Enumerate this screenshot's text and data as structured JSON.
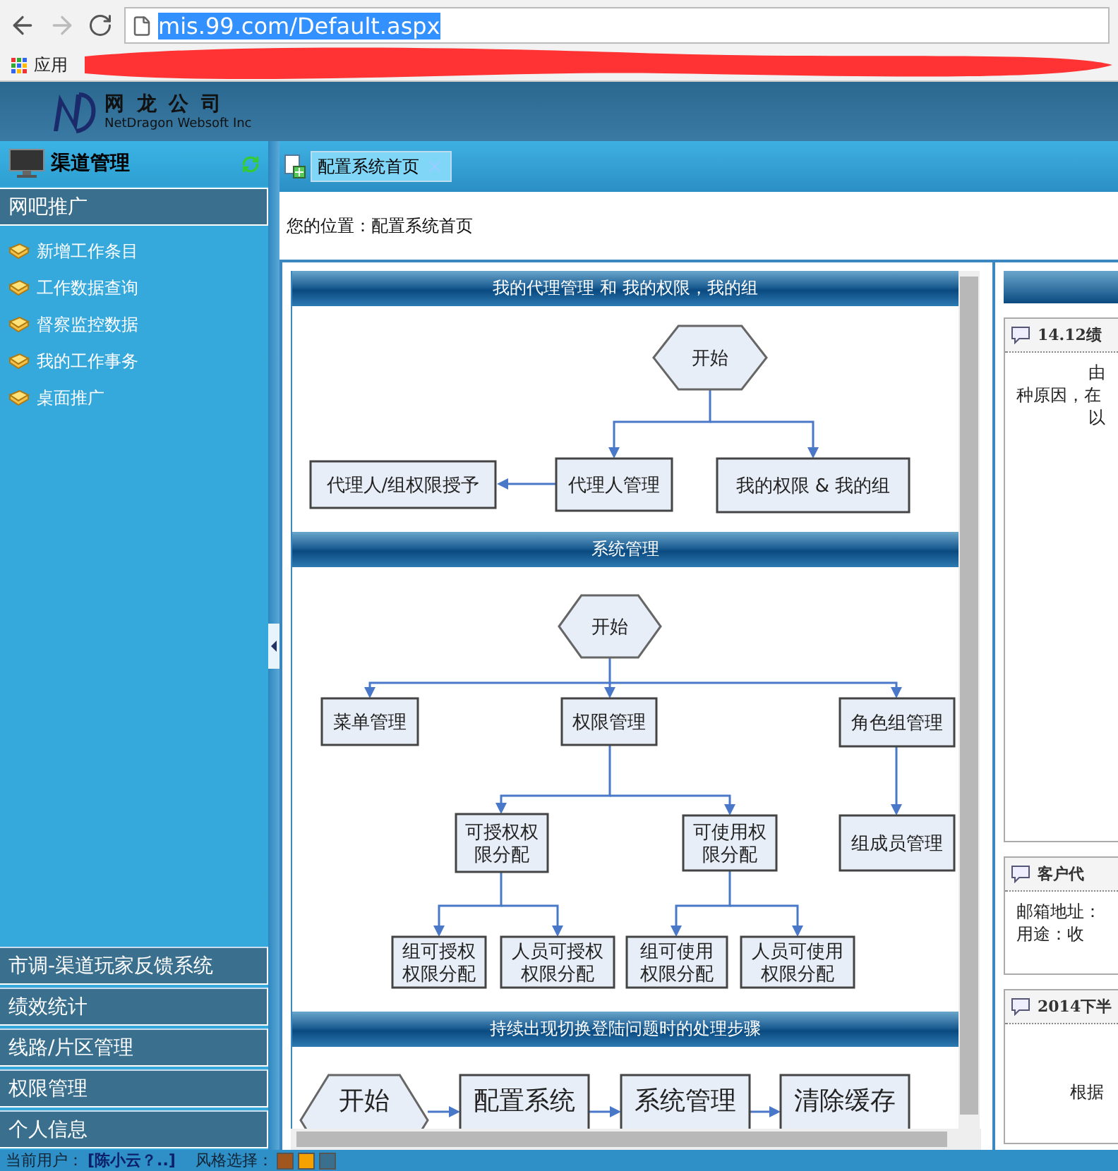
{
  "browser": {
    "url": "mis.99.com/Default.aspx",
    "url_selected": true,
    "bookmarks_label": "应用"
  },
  "header": {
    "logo_cn": "网 龙 公 司",
    "logo_en": "NetDragon Websoft Inc"
  },
  "sidebar": {
    "title": "渠道管理",
    "sections": [
      {
        "label": "网吧推广",
        "expanded": true,
        "items": [
          "新增工作条目",
          "工作数据查询",
          "督察监控数据",
          "我的工作事务",
          "桌面推广"
        ]
      },
      {
        "label": "市调-渠道玩家反馈系统",
        "expanded": false
      },
      {
        "label": "绩效统计",
        "expanded": false
      },
      {
        "label": "线路/片区管理",
        "expanded": false
      },
      {
        "label": "权限管理",
        "expanded": false
      },
      {
        "label": "个人信息",
        "expanded": false
      }
    ]
  },
  "tabs": [
    {
      "label": "配置系统首页",
      "selected": true
    }
  ],
  "breadcrumb": "您的位置：配置系统首页",
  "flowcharts": [
    {
      "title": "我的代理管理 和 我的权限，我的组",
      "nodes": [
        {
          "kind": "start",
          "lines": [
            "开始"
          ]
        },
        {
          "kind": "process",
          "lines": [
            "代理人/组权限授予"
          ]
        },
        {
          "kind": "process",
          "lines": [
            "代理人管理"
          ]
        },
        {
          "kind": "process",
          "lines": [
            "我的权限 & 我的组"
          ]
        }
      ]
    },
    {
      "title": "系统管理",
      "nodes": [
        {
          "kind": "start",
          "lines": [
            "开始"
          ]
        },
        {
          "kind": "process",
          "lines": [
            "菜单管理"
          ]
        },
        {
          "kind": "process",
          "lines": [
            "权限管理"
          ]
        },
        {
          "kind": "process",
          "lines": [
            "角色组管理"
          ]
        },
        {
          "kind": "process",
          "lines": [
            "可授权权",
            "限分配"
          ]
        },
        {
          "kind": "process",
          "lines": [
            "可使用权",
            "限分配"
          ]
        },
        {
          "kind": "process",
          "lines": [
            "组成员管理"
          ]
        },
        {
          "kind": "process",
          "lines": [
            "组可授权",
            "权限分配"
          ]
        },
        {
          "kind": "process",
          "lines": [
            "人员可授权",
            "权限分配"
          ]
        },
        {
          "kind": "process",
          "lines": [
            "组可使用",
            "权限分配"
          ]
        },
        {
          "kind": "process",
          "lines": [
            "人员可使用",
            "权限分配"
          ]
        }
      ]
    },
    {
      "title": "持续出现切换登陆问题时的处理步骤",
      "nodes": [
        {
          "kind": "start",
          "lines": [
            "开始"
          ]
        },
        {
          "kind": "process",
          "lines": [
            "配置系统"
          ]
        },
        {
          "kind": "process",
          "lines": [
            "系统管理"
          ]
        },
        {
          "kind": "process",
          "lines": [
            "清除缓存"
          ]
        }
      ]
    }
  ],
  "notices": [
    {
      "title": "14.12绩",
      "lines": [
        "由",
        "种原因，在",
        "以"
      ]
    },
    {
      "title": "客户代",
      "lines": [
        "邮箱地址：",
        "用途：收"
      ]
    },
    {
      "title": "2014下半",
      "lines": [
        "根据"
      ]
    }
  ],
  "status_bar": {
    "user_label": "当前用户：",
    "user": "[陈小云？..]",
    "style_label": "风格选择：",
    "styles": [
      {
        "color": "#a0561c"
      },
      {
        "color": "#f5a100"
      },
      {
        "color": "#3a6f8e"
      }
    ]
  }
}
